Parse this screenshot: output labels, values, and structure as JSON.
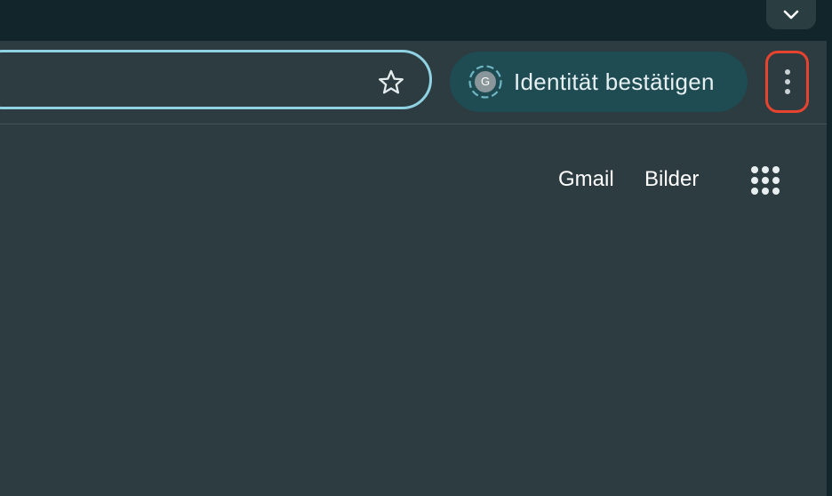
{
  "tabstrip": {
    "tab_search_icon": "chevron-down-icon"
  },
  "toolbar": {
    "bookmark_icon": "star-icon",
    "identity": {
      "avatar_letter": "G",
      "label": "Identität bestätigen"
    },
    "menu_icon": "three-dots-vertical-icon"
  },
  "content": {
    "links": {
      "gmail": "Gmail",
      "images": "Bilder"
    },
    "apps_icon": "apps-grid-icon"
  },
  "colors": {
    "tabstrip_bg": "#12252a",
    "toolbar_bg": "#2d3c40",
    "omnibox_border": "#8fd3e3",
    "identity_chip_bg": "#1f4b52",
    "menu_highlight": "#e8432f"
  }
}
